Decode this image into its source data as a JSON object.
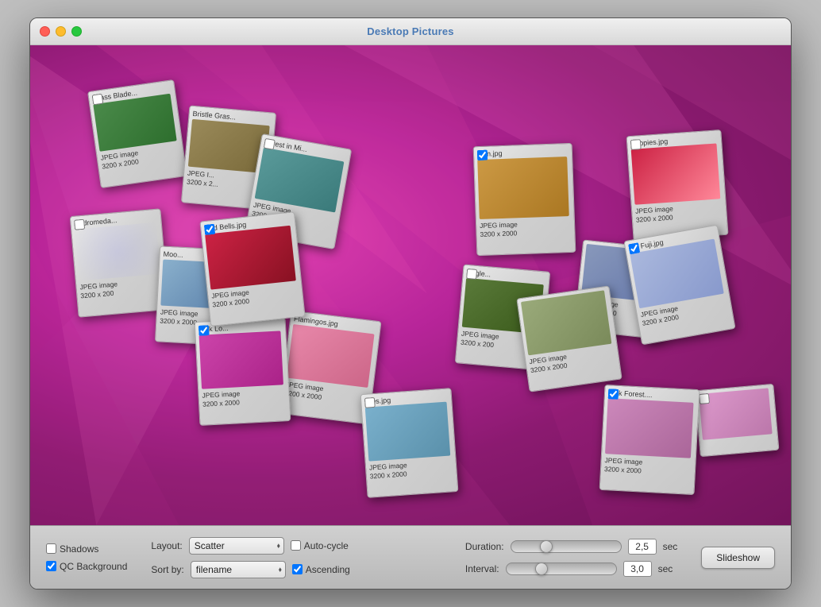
{
  "window": {
    "title": "Desktop Pictures"
  },
  "toolbar": {
    "shadows_label": "Shadows",
    "qc_background_label": "QC Background",
    "layout_label": "Layout:",
    "sort_label": "Sort by:",
    "layout_value": "Scatter",
    "sort_value": "filename",
    "auto_cycle_label": "Auto-cycle",
    "ascending_label": "Ascending",
    "duration_label": "Duration:",
    "interval_label": "Interval:",
    "duration_value": "2,5",
    "interval_value": "3,0",
    "sec_label": "sec",
    "slideshow_label": "Slideshow"
  },
  "slides": [
    {
      "name": "Grass Blade...",
      "info": "JPEG image\n3200 x 2000",
      "checked": false,
      "color1": "#4a8a4a",
      "color2": "#2d6e2d"
    },
    {
      "name": "Bristle Gras...",
      "info": "JPEG image\n3200 x 2000",
      "checked": false,
      "color1": "#8a7a4a",
      "color2": "#6a5a2d"
    },
    {
      "name": "Forest in Mi...",
      "info": "JPEG image\n3200 x 2000",
      "checked": false,
      "color1": "#4a8a8a",
      "color2": "#2d6a6a"
    },
    {
      "name": "Andromeda...",
      "info": "JPEG image\n3200 x 2000",
      "checked": false,
      "color1": "#1a1a4a",
      "color2": "#0a0a2d"
    },
    {
      "name": "Moo...",
      "info": "JPEG image\n3200 x 2000",
      "checked": false,
      "color1": "#6a8aaa",
      "color2": "#4a6a8a"
    },
    {
      "name": "Red Bells.jpg",
      "info": "JPEG image\n3200 x 2000",
      "checked": true,
      "color1": "#aa2a2a",
      "color2": "#8a1a1a"
    },
    {
      "name": "Pink Lo...",
      "info": "JPEG image\n3200 x 2000",
      "checked": true,
      "color1": "#cc44aa",
      "color2": "#aa2a8a"
    },
    {
      "name": "Flamingos.jpg",
      "info": "JPEG image\n3200 x 2000",
      "checked": false,
      "color1": "#e888aa",
      "color2": "#cc6688"
    },
    {
      "name": "Isles.jpg",
      "info": "JPEG image\n3200 x 2000",
      "checked": false,
      "color1": "#8ab0cc",
      "color2": "#6a90aa"
    },
    {
      "name": "Lion.jpg",
      "info": "JPEG image\n3200 x 2000",
      "checked": true,
      "color1": "#cc9944",
      "color2": "#aa7722"
    },
    {
      "name": "Eagle...",
      "info": "JPEG image\n3200 x 2000",
      "checked": false,
      "color1": "#4a6a2a",
      "color2": "#2a4a0a"
    },
    {
      "name": "Poppies.jpg",
      "info": "JPEG image\n3200 x 2000",
      "checked": false,
      "color1": "#cc2244",
      "color2": "#aa0a22"
    },
    {
      "name": "Mt. Fuji.jpg",
      "info": "JPEG image\n3200 x 2000",
      "checked": true,
      "color1": "#8898bb",
      "color2": "#6678aa"
    },
    {
      "name": "Pink Forest...",
      "info": "JPEG image\n3200 x 2000",
      "checked": true,
      "color1": "#cc88bb",
      "color2": "#aa6699"
    }
  ]
}
